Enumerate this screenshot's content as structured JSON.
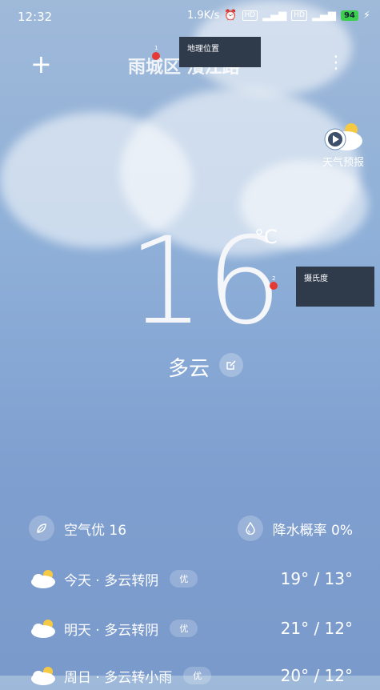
{
  "status_bar": {
    "time": "12:32",
    "speed": "1.9K/s",
    "battery": "94"
  },
  "header": {
    "location": "雨城区 濱江路",
    "tooltip_location": "地理位置",
    "marker_1": "1"
  },
  "forecast_button": {
    "label": "天气预报"
  },
  "current": {
    "temperature": "16",
    "unit": "°C",
    "tooltip_unit": "摄氏度",
    "marker_2": "2",
    "condition": "多云"
  },
  "metrics": {
    "air_quality": "空气优 16",
    "precip": "降水概率 0%"
  },
  "daily": [
    {
      "day": "今天 · 多云转阴",
      "quality": "优",
      "temps": "19° / 13°"
    },
    {
      "day": "明天 · 多云转阴",
      "quality": "优",
      "temps": "21° / 12°"
    },
    {
      "day": "周日 · 多云转小雨",
      "quality": "优",
      "temps": "20° / 12°"
    }
  ],
  "colors": {
    "accent_marker": "#e53935",
    "tooltip_bg": "#2f3a4a",
    "battery": "#3ccf4e"
  }
}
